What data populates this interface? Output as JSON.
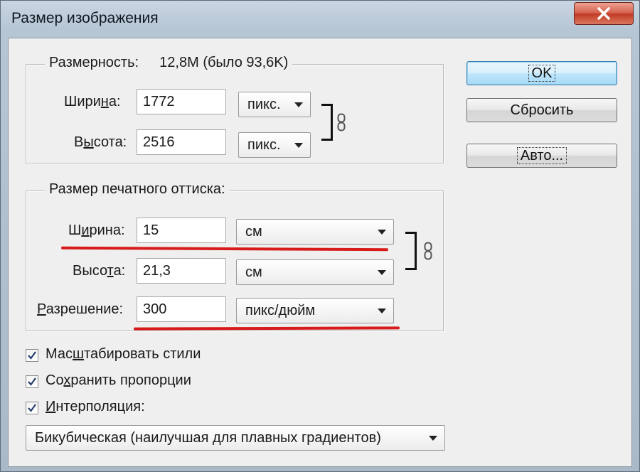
{
  "window": {
    "title": "Размер изображения"
  },
  "pixel_dimensions": {
    "label": "Размерность:",
    "value": "12,8M (было 93,6K)",
    "width": {
      "label_before": "Шири",
      "label_underlined": "н",
      "label_after": "а:",
      "value": "1772",
      "unit": "пикс."
    },
    "height": {
      "label_before": "В",
      "label_underlined": "ы",
      "label_after": "сота:",
      "value": "2516",
      "unit": "пикс."
    }
  },
  "document_size": {
    "title": "Размер печатного оттиска:",
    "width": {
      "label_before": "Ш",
      "label_underlined": "и",
      "label_after": "рина:",
      "value": "15",
      "unit": "см"
    },
    "height": {
      "label_before": "Высо",
      "label_underlined": "т",
      "label_after": "а:",
      "value": "21,3",
      "unit": "см"
    },
    "resolution": {
      "label_before": "",
      "label_underlined": "Р",
      "label_after": "азрешение:",
      "value": "300",
      "unit": "пикс/дюйм"
    }
  },
  "buttons": {
    "ok": "OK",
    "reset": "Сбросить",
    "auto": "Авто..."
  },
  "options": {
    "scale_styles": {
      "before": "Мас",
      "underlined": "ш",
      "after": "табировать стили",
      "checked": true
    },
    "constrain": {
      "before": "Со",
      "underlined": "х",
      "after": "ранить пропорции",
      "checked": true
    },
    "resample": {
      "before": "",
      "underlined": "И",
      "after": "нтерполяция:",
      "checked": true
    },
    "method": "Бикубическая (наилучшая для плавных градиентов)"
  },
  "colors": {
    "annotation_red": "#d71a1a",
    "close_red": "#c13a24"
  },
  "icons": {
    "close": "close-icon",
    "link": "chain-link-icon",
    "check": "checkmark-icon",
    "dropdown": "chevron-down-icon"
  }
}
